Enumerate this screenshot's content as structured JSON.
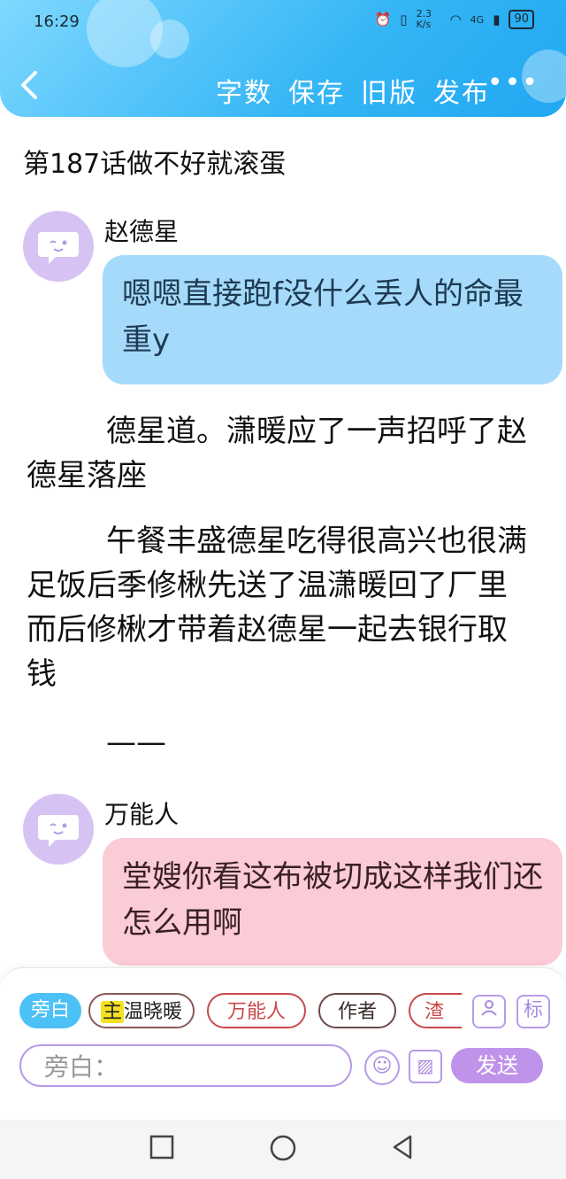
{
  "status_bar": {
    "time": "16:29",
    "net_speed": "2.3 K/s",
    "signal_label": "4G",
    "battery": "90"
  },
  "nav": {
    "back_icon": "chevron-left-icon",
    "actions": [
      "字数",
      "保存",
      "旧版",
      "发布"
    ],
    "more_label": "•••"
  },
  "chapter_title": "第187话做不好就滚蛋",
  "messages": [
    {
      "speaker": "赵德星",
      "text": "嗯嗯直接跑f没什么丢人的命最重y",
      "bubble_color": "#a6dafa"
    },
    {
      "speaker": "万能人",
      "text": "堂嫂你看这布被切成这样我们还怎么用啊",
      "bubble_color": "#fbcbd6"
    }
  ],
  "narrations": [
    "德星道。潇暖应了一声招呼了赵德星落座",
    "午餐丰盛德星吃得很高兴也很满足饭后季修楸先送了温潇暖回了厂里而后修楸才带着赵德星一起去银行取钱"
  ],
  "separator": "——",
  "composer": {
    "chips": [
      "旁白",
      "温晓暖",
      "万能人",
      "作者",
      "渣"
    ],
    "main_badge": "主",
    "role_icon": "person-card-icon",
    "mark_label": "标",
    "input_placeholder": "旁白：",
    "send_label": "发送"
  },
  "colors": {
    "header": "#34b5f5",
    "send_button": "#c093ea",
    "avatar": "#d7c2f4"
  }
}
